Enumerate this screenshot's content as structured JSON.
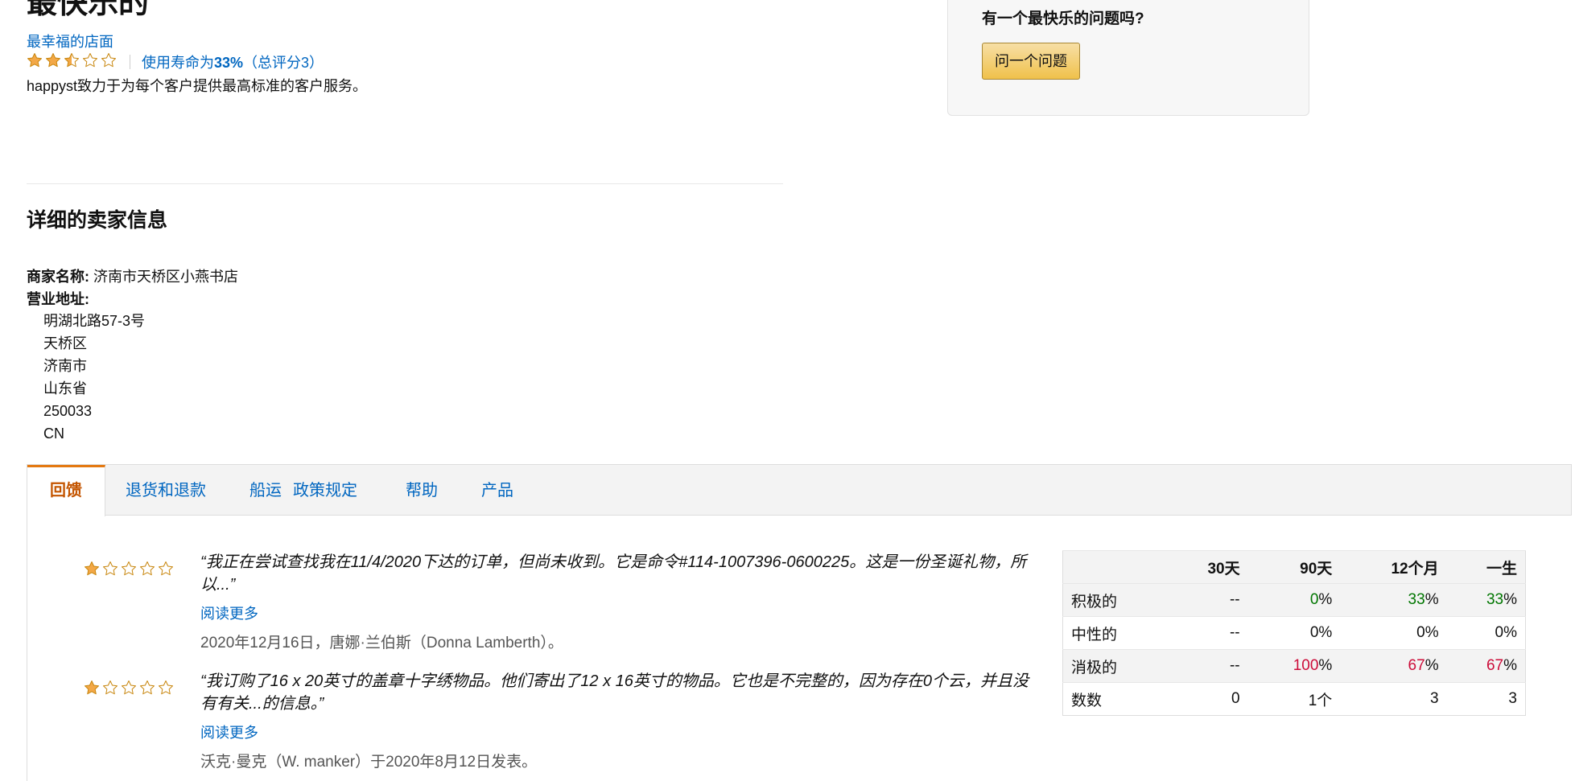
{
  "header": {
    "seller_name": "最快乐的",
    "storefront_link": "最幸福的店面",
    "rating": {
      "stars": 2.5,
      "text_prefix": "使用寿命为",
      "percent": "33%",
      "text_suffix": "（总评分3）"
    },
    "description": "happyst致力于为每个客户提供最高标准的客户服务。"
  },
  "question_box": {
    "title": "有一个最快乐的问题吗?",
    "button_label": "问一个问题"
  },
  "details": {
    "heading": "详细的卖家信息",
    "business_name_label": "商家名称:",
    "business_name": "济南市天桥区小燕书店",
    "address_label": "营业地址:",
    "address_lines": [
      "明湖北路57-3号",
      "天桥区",
      "济南市",
      "山东省",
      "250033",
      "CN"
    ]
  },
  "tabs": [
    {
      "label": "回馈",
      "active": true
    },
    {
      "label": "退货和退款",
      "active": false
    },
    {
      "label": "船运",
      "active": false
    },
    {
      "label": "政策规定",
      "active": false
    },
    {
      "label": "帮助",
      "active": false
    },
    {
      "label": "产品",
      "active": false
    }
  ],
  "feedback": [
    {
      "stars": 1,
      "quote": "“我正在尝试查找我在11/4/2020下达的订单，但尚未收到。它是命令#114-1007396-0600225。这是一份圣诞礼物，所以...”",
      "read_more": "阅读更多",
      "author": "2020年12月16日，唐娜·兰伯斯（Donna Lamberth）。"
    },
    {
      "stars": 1,
      "quote": "“我订购了16 x 20英寸的盖章十字绣物品。他们寄出了12 x 16英寸的物品。它也是不完整的，因为存在0个云，并且没有有关...的信息。”",
      "read_more": "阅读更多",
      "author": "沃克·曼克（W. manker）于2020年8月12日发表。"
    }
  ],
  "stats": {
    "headers": [
      "",
      "30天",
      "90天",
      "12个月",
      "一生"
    ],
    "rows": [
      {
        "label": "积极的",
        "cells": [
          {
            "v": "--"
          },
          {
            "num": "0",
            "unit": "%",
            "cls": "pos"
          },
          {
            "num": "33",
            "unit": "%",
            "cls": "pos"
          },
          {
            "num": "33",
            "unit": "%",
            "cls": "pos"
          }
        ]
      },
      {
        "label": "中性的",
        "cells": [
          {
            "v": "--"
          },
          {
            "num": "0",
            "unit": "%"
          },
          {
            "num": "0",
            "unit": "%"
          },
          {
            "num": "0",
            "unit": "%"
          }
        ]
      },
      {
        "label": "消极的",
        "cells": [
          {
            "v": "--"
          },
          {
            "num": "100",
            "unit": "%",
            "cls": "neg"
          },
          {
            "num": "67",
            "unit": "%",
            "cls": "neg"
          },
          {
            "num": "67",
            "unit": "%",
            "cls": "neg"
          }
        ]
      },
      {
        "label": "数数",
        "cells": [
          {
            "v": "0"
          },
          {
            "v": "1个"
          },
          {
            "v": "3"
          },
          {
            "v": "3"
          }
        ]
      }
    ]
  },
  "colors": {
    "link": "#0066c0",
    "active_tab": "#c45500",
    "star": "#f3a847",
    "positive": "#007600",
    "negative": "#cc0c39"
  }
}
